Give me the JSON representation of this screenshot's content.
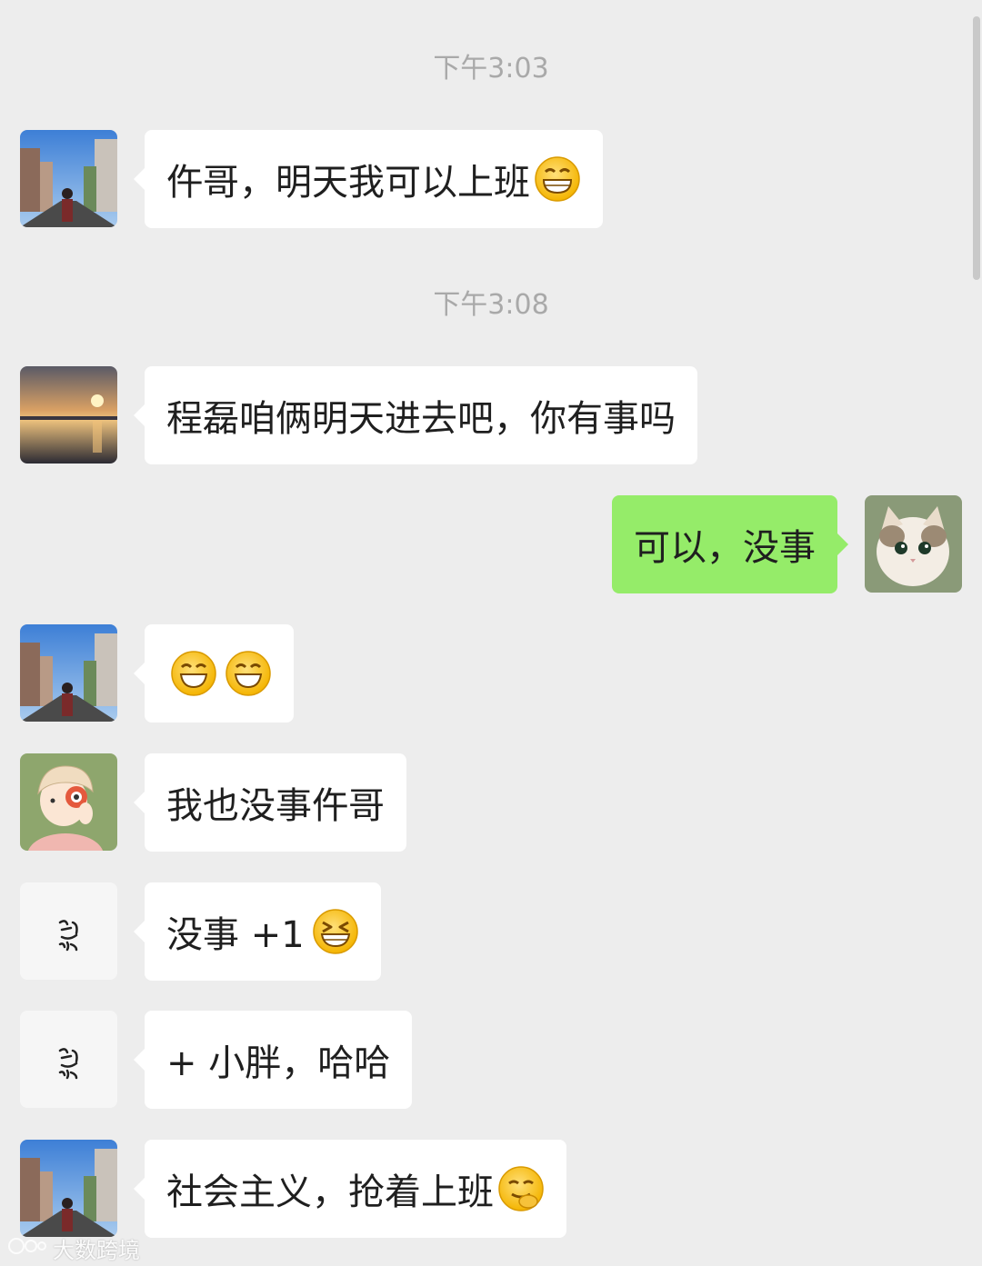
{
  "timestamps": [
    "下午3:03",
    "下午3:08"
  ],
  "messages": [
    {
      "direction": "incoming",
      "avatar": "street-photo-avatar",
      "text": "仵哥，明天我可以上班",
      "emojis": [
        "grin-emoji"
      ]
    },
    {
      "direction": "incoming",
      "avatar": "sunset-photo-avatar",
      "text": "程磊咱俩明天进去吧，你有事吗",
      "emojis": []
    },
    {
      "direction": "outgoing",
      "avatar": "cat-photo-avatar",
      "text": "可以，没事",
      "emojis": []
    },
    {
      "direction": "incoming",
      "avatar": "street-photo-avatar",
      "text": "",
      "emojis": [
        "smile-emoji",
        "smile-emoji"
      ]
    },
    {
      "direction": "incoming",
      "avatar": "cartoon-camera-avatar",
      "text": "我也没事仵哥",
      "emojis": []
    },
    {
      "direction": "incoming",
      "avatar": "calligraphy-avatar",
      "text": "没事 +1",
      "emojis": [
        "laugh-squint-emoji"
      ]
    },
    {
      "direction": "incoming",
      "avatar": "calligraphy-avatar",
      "text": "+ 小胖，哈哈",
      "emojis": []
    },
    {
      "direction": "incoming",
      "avatar": "street-photo-avatar",
      "text": "社会主义，抢着上班",
      "emojis": [
        "smirk-emoji"
      ]
    }
  ],
  "watermark": "大数跨境",
  "colors": {
    "background": "#ededed",
    "incoming_bubble": "#ffffff",
    "outgoing_bubble": "#95ec69",
    "timestamp_text": "#a9a9a9",
    "message_text": "#1f1f1f"
  }
}
